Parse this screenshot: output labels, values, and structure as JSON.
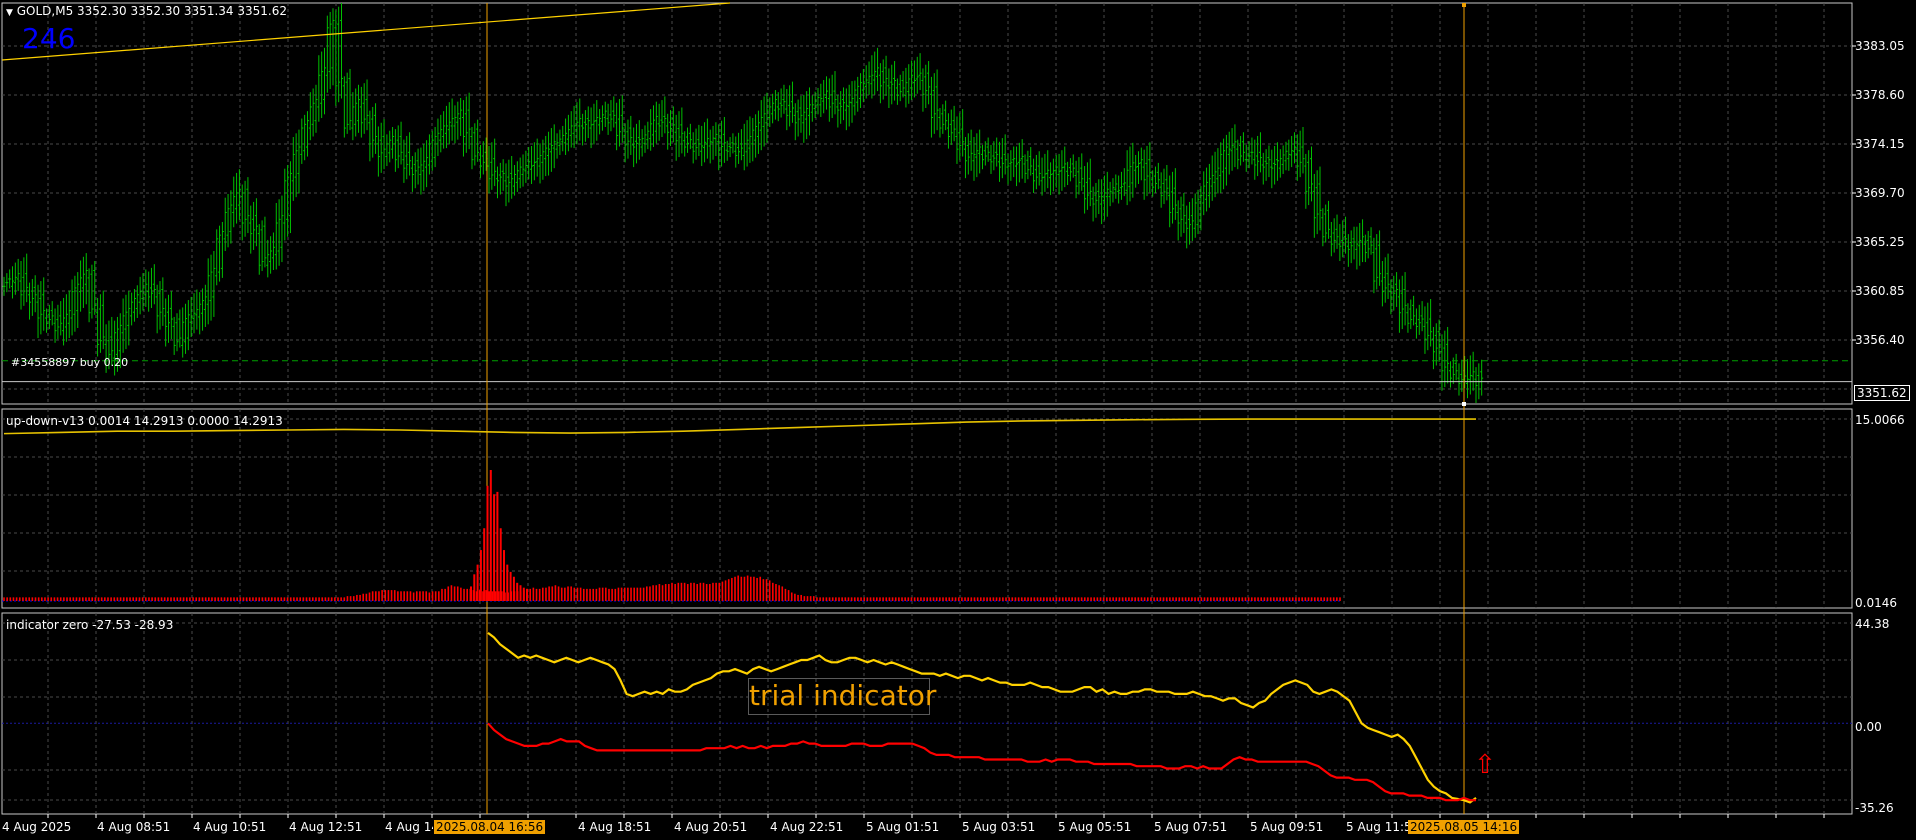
{
  "main_panel": {
    "header": "GOLD,M5  3352.30 3352.30 3351.34 3351.62",
    "counter": "246",
    "order_label": "#34558897 buy 0.20",
    "current_price": "3351.62",
    "y_ticks": [
      "3383.05",
      "3378.60",
      "3374.15",
      "3369.70",
      "3365.25",
      "3360.85",
      "3356.40"
    ],
    "order_price": 3353.6,
    "bid": 3351.62
  },
  "updown_panel": {
    "header": "up-down-v13 0.0014 14.2913 0.0000 14.2913",
    "y_top": "15.0066",
    "y_bottom": "0.0146"
  },
  "zero_panel": {
    "header": "indicator zero -27.53 -28.93",
    "watermark": "trial indicator",
    "y_top": "44.38",
    "y_mid": "0.00",
    "y_bottom": "-35.26",
    "arrow": "⇧"
  },
  "x_axis": {
    "labels": [
      "4 Aug 2025",
      "4 Aug 08:51",
      "4 Aug 10:51",
      "4 Aug 12:51",
      "4 Aug 14:51",
      "4 Aug 18:51",
      "4 Aug 20:51",
      "4 Aug 22:51",
      "5 Aug 01:51",
      "5 Aug 03:51",
      "5 Aug 05:51",
      "5 Aug 07:51",
      "5 Aug 09:51",
      "5 Aug 11:51"
    ],
    "marker1": "2025.08.04 16:56",
    "marker2": "2025.08.05 14:16"
  },
  "colors": {
    "bars": "#00c000",
    "grid": "#4a4a4a",
    "yellow": "#ffd200",
    "red": "#ff0000",
    "vline": "#f0a000",
    "blue": "#0000ff",
    "updown_line": "#e6c200"
  },
  "chart_data": [
    {
      "type": "line",
      "title": "GOLD,M5",
      "y_range": [
        3349.5,
        3387.5
      ],
      "series": [
        {
          "name": "GOLD,M5",
          "values": [
            3361,
            3361.5,
            3360.2,
            3359.5,
            3358,
            3357.5,
            3356.8,
            3358,
            3360.5,
            3361.8,
            3358.5,
            3355.5,
            3354.2,
            3356.6,
            3358.2,
            3359.5,
            3360.5,
            3360,
            3358.2,
            3357.2,
            3355.4,
            3357.6,
            3358.1,
            3359.3,
            3362,
            3365.5,
            3368,
            3369.5,
            3367,
            3366,
            3363,
            3364,
            3367,
            3371,
            3373.5,
            3376,
            3378,
            3381,
            3385.5,
            3380,
            3376,
            3378,
            3376.5,
            3374.5,
            3373.3,
            3374.5,
            3373,
            3372.2,
            3371.6,
            3372.5,
            3374.5,
            3375.5,
            3376.2,
            3377,
            3375.2,
            3373,
            3372.4,
            3371.2,
            3371,
            3370.5,
            3371.6,
            3372.1,
            3372.4,
            3373.4,
            3374,
            3374.6,
            3375.5,
            3376.2,
            3376,
            3376.3,
            3376.9,
            3376.5,
            3375.3,
            3374.4,
            3374.2,
            3375,
            3376.4,
            3376.2,
            3375.6,
            3374.8,
            3374.2,
            3373.8,
            3374.3,
            3374.7,
            3373.9,
            3373.8,
            3373.4,
            3374.5,
            3375.8,
            3377,
            3378,
            3377.8,
            3377.2,
            3376.5,
            3377.5,
            3378.2,
            3378.8,
            3378,
            3377.7,
            3378.1,
            3379.6,
            3380.2,
            3381,
            3380,
            3379.8,
            3379.1,
            3380.3,
            3380.5,
            3379.2,
            3377,
            3376,
            3375.2,
            3374,
            3372.9,
            3373.5,
            3373,
            3372.8,
            3372.3,
            3372.4,
            3372.6,
            3371.7,
            3371,
            3371.3,
            3371.6,
            3371.9,
            3371.5,
            3370.5,
            3369.3,
            3368.8,
            3369.5,
            3370,
            3370.1,
            3372,
            3372.3,
            3371.1,
            3370.4,
            3369.6,
            3368,
            3367,
            3366.5,
            3368.9,
            3370.5,
            3371.5,
            3373.5,
            3374,
            3373,
            3373,
            3372.5,
            3372.3,
            3372.2,
            3373.1,
            3373.5,
            3372.4,
            3370,
            3367.5,
            3365.7,
            3365,
            3364.8,
            3364.5,
            3365,
            3364.2,
            3361.5,
            3360.5,
            3360,
            3358.5,
            3357.5,
            3357.2,
            3356,
            3354.8,
            3353,
            3352.3,
            3351.8,
            3352.2,
            3351.6
          ]
        },
        {
          "name": "order",
          "values": [
            3353.6
          ]
        }
      ]
    },
    {
      "type": "bar",
      "title": "up-down-v13",
      "y_range": [
        0,
        15.0066
      ],
      "series": [
        {
          "name": "histogram",
          "values": [
            0.3,
            0.3,
            0.3,
            0.3,
            0.3,
            0.3,
            0.3,
            0.3,
            0.3,
            0.3,
            0.3,
            0.3,
            0.3,
            0.3,
            0.3,
            0.3,
            0.3,
            0.3,
            0.3,
            0.3,
            0.3,
            0.3,
            0.3,
            0.3,
            0.3,
            0.3,
            0.3,
            0.3,
            0.3,
            0.3,
            0.3,
            0.3,
            0.3,
            0.3,
            0.3,
            0.3,
            0.3,
            0.3,
            0.3,
            0.3,
            0.3,
            0.3,
            0.3,
            0.3,
            0.3,
            0.3,
            0.3,
            0.3,
            0.3,
            0.3,
            0.3,
            0.3,
            0.3,
            0.3,
            0.3,
            0.3,
            0.3,
            0.3,
            0.3,
            0.3,
            0.3,
            0.3,
            0.3,
            0.3,
            0.3,
            0.3,
            0.3,
            0.3,
            0.3,
            0.3,
            0.3,
            0.3,
            0.3,
            0.3,
            0.3,
            0.3,
            0.3,
            0.3,
            0.3,
            0.3,
            0.3,
            0.3,
            0.3,
            0.3,
            0.3,
            0.3,
            0.3,
            0.3,
            0.3,
            0.3,
            0.3,
            0.3,
            0.3,
            0.3,
            0.3,
            0.3,
            0.3,
            0.3,
            0.3,
            0.3,
            0.3,
            0.3,
            0.3,
            0.3,
            0.3,
            0.3,
            0.3,
            0.3,
            0.3,
            0.4,
            0.4,
            0.4,
            0.5,
            0.5,
            0.6,
            0.6,
            0.7,
            0.8,
            0.8,
            0.8,
            0.9,
            0.9,
            0.9,
            0.9,
            0.9,
            0.8,
            0.8,
            0.8,
            0.8,
            0.8,
            0.7,
            0.8,
            0.8,
            0.8,
            0.8,
            0.7,
            0.8,
            0.8,
            0.8,
            1.0,
            1.0,
            1.2,
            1.3,
            1.2,
            1.2,
            1.1,
            1.0,
            1.0,
            1.0,
            0.9,
            0.8,
            0.9,
            0.8,
            0.9,
            0.8,
            0.8,
            0.8,
            0.8,
            0.8,
            0.7,
            0.7,
            0.8,
            0.8,
            0.8,
            0.8,
            0.9,
            1.0,
            1.0,
            1.1,
            1.0,
            1.0,
            1.1,
            1.1,
            1.2,
            1.2,
            1.3,
            1.2,
            1.1,
            1.1,
            1.2,
            1.2,
            1.1,
            1.1,
            1.1,
            1.0,
            1.0,
            1.0,
            1.0,
            1.0,
            1.1,
            1.1,
            1.1,
            1.0,
            1.0,
            1.0,
            1.1,
            1.1,
            1.1,
            1.1,
            1.1,
            1.1,
            1.1,
            1.1,
            1.1,
            1.2,
            1.2,
            1.3,
            1.3,
            1.4,
            1.3,
            1.4,
            1.4,
            1.5,
            1.4,
            1.5,
            1.5,
            1.5,
            1.4,
            1.5,
            1.5,
            1.4,
            1.5,
            1.5,
            1.4,
            1.4,
            1.5,
            1.5,
            1.5,
            1.6,
            1.7,
            1.8,
            1.9,
            2.0,
            2.1,
            2.0,
            2.0,
            2.1,
            2.0,
            2.0,
            1.9,
            2.0,
            1.8,
            1.8,
            1.7,
            1.5,
            1.4,
            1.3,
            1.2,
            1.0,
            0.9,
            0.7,
            0.6,
            0.5,
            0.5,
            0.4,
            0.4,
            0.4,
            0.4,
            0.3,
            0.3,
            0.3,
            0.3,
            0.3,
            0.3,
            0.3,
            0.3,
            0.3,
            0.3,
            0.3,
            0.3,
            0.3,
            0.3,
            0.3,
            0.3,
            0.3,
            0.3,
            0.3,
            0.3,
            0.3,
            0.3,
            0.3,
            0.3,
            0.3,
            0.3,
            0.3,
            0.3,
            0.3,
            0.3,
            0.3,
            0.3,
            0.3,
            0.3,
            0.3,
            0.3,
            0.3,
            0.3,
            0.3,
            0.3,
            0.3,
            0.3,
            0.3,
            0.3,
            0.3,
            0.3,
            0.3,
            0.3,
            0.3,
            0.3,
            0.3,
            0.3,
            0.3,
            0.3,
            0.3,
            0.3,
            0.3,
            0.3,
            0.3,
            0.3,
            0.3,
            0.3,
            0.3,
            0.3,
            0.3,
            0.3,
            0.3,
            0.3,
            0.3,
            0.3,
            0.3,
            0.3,
            0.3,
            0.3,
            0.3,
            0.3,
            0.3,
            0.3,
            0.3,
            0.3,
            0.3,
            0.3,
            0.3,
            0.3,
            0.3,
            0.3,
            0.3,
            0.3,
            0.3,
            0.3,
            0.3,
            0.3,
            0.3,
            0.3,
            0.3,
            0.3,
            0.3,
            0.3,
            0.3,
            0.3,
            0.3,
            0.3,
            0.3,
            0.3,
            0.3,
            0.3,
            0.3,
            0.3,
            0.3,
            0.3,
            0.3,
            0.3,
            0.3,
            0.3,
            0.3,
            0.3,
            0.3,
            0.3,
            0.3,
            0.3,
            0.3,
            0.3,
            0.3,
            0.3,
            0.3,
            0.3,
            0.3,
            0.3,
            0.3,
            0.3,
            0.3,
            0.3,
            0.3,
            0.3,
            0.3,
            0.3,
            0.3,
            0.3,
            0.3,
            0.3,
            0.3,
            0.3,
            0.3,
            0.3,
            0.3,
            0.3,
            0.3,
            0.3,
            0.3,
            0.3,
            0.3,
            0.3,
            0.3,
            0.3,
            0.3,
            0.3,
            0.3,
            0.3,
            0.3,
            0.3,
            0.3,
            0.3,
            0.3,
            0.3,
            0.3,
            0.3,
            0.3
          ]
        },
        {
          "name": "spike",
          "values": [
            1.2,
            2.2,
            3.0,
            4.2,
            6.0,
            9.5,
            10.8,
            8.8,
            9.0,
            6.0,
            4.2,
            3.0,
            2.4,
            2.0,
            1.5,
            1.3,
            1.1,
            1.0
          ]
        },
        {
          "name": "up-down line",
          "values": [
            13.8,
            13.9,
            14.0,
            14.0,
            14.05,
            14.1,
            14.15,
            14.1,
            14.0,
            13.9,
            13.85,
            13.9,
            14.0,
            14.15,
            14.3,
            14.45,
            14.6,
            14.75,
            14.85,
            14.9,
            14.95,
            14.98,
            15.0,
            15.0,
            15.0,
            15.0,
            15.0
          ]
        }
      ]
    },
    {
      "type": "line",
      "title": "indicator zero",
      "y_range": [
        -35.26,
        44.38
      ],
      "series": [
        {
          "name": "yellow",
          "values": [
            40,
            38,
            35,
            33,
            31,
            29,
            30,
            29,
            30,
            29,
            28,
            27,
            28,
            29,
            28,
            27,
            28,
            29,
            28,
            27,
            26,
            24,
            19,
            13,
            12,
            13,
            14,
            13,
            14,
            13,
            15,
            14,
            14,
            15,
            17,
            18,
            19,
            20,
            22,
            23,
            23,
            24,
            23,
            22,
            24,
            25,
            24,
            23,
            24,
            25,
            26,
            27,
            28,
            28,
            29,
            30,
            28,
            27,
            27,
            28,
            29,
            29,
            28,
            27,
            28,
            27,
            26,
            27,
            26,
            25,
            24,
            23,
            22,
            22,
            22,
            21,
            22,
            21,
            20,
            21,
            21,
            20,
            19,
            20,
            19,
            18,
            18,
            17,
            17,
            17,
            18,
            17,
            16,
            16,
            15,
            14,
            14,
            14,
            15,
            16,
            16,
            14,
            15,
            13,
            14,
            13,
            13,
            14,
            14,
            15,
            15,
            14,
            14,
            14,
            13,
            13,
            13,
            14,
            13,
            12,
            12,
            11,
            10,
            11,
            11,
            9,
            8,
            7,
            9,
            10,
            13,
            15,
            17,
            18,
            19,
            18,
            17,
            14,
            13,
            14,
            15,
            14,
            12,
            10,
            5,
            0,
            -2,
            -3,
            -4,
            -5,
            -6,
            -5,
            -7,
            -10,
            -15,
            -20,
            -25,
            -28,
            -30,
            -31,
            -33,
            -33.5,
            -34,
            -35,
            -33
          ]
        },
        {
          "name": "red",
          "values": [
            0,
            -3,
            -5,
            -7,
            -8,
            -9,
            -10,
            -10,
            -10,
            -9,
            -9,
            -8,
            -7,
            -8,
            -8,
            -8,
            -10,
            -11,
            -12,
            -12,
            -12,
            -12,
            -12,
            -12,
            -12,
            -12,
            -12,
            -12,
            -12,
            -12,
            -12,
            -12,
            -12,
            -12,
            -12,
            -12,
            -11,
            -11,
            -11,
            -11,
            -10,
            -11,
            -10,
            -11,
            -11,
            -10,
            -11,
            -10,
            -10,
            -10,
            -9,
            -9,
            -8,
            -9,
            -9,
            -10,
            -10,
            -10,
            -10,
            -10,
            -9,
            -9,
            -9,
            -10,
            -10,
            -10,
            -9,
            -9,
            -9,
            -9,
            -9,
            -10,
            -11,
            -13,
            -14,
            -14,
            -14,
            -15,
            -15,
            -15,
            -15,
            -15,
            -16,
            -16,
            -16,
            -16,
            -16,
            -16,
            -16,
            -17,
            -17,
            -17,
            -16,
            -17,
            -16,
            -16,
            -16,
            -17,
            -17,
            -17,
            -18,
            -18,
            -18,
            -18,
            -18,
            -18,
            -18,
            -19,
            -19,
            -19,
            -19,
            -19,
            -20,
            -20,
            -20,
            -19,
            -19,
            -20,
            -19,
            -20,
            -20,
            -20,
            -18,
            -16,
            -15,
            -16,
            -16,
            -17,
            -17,
            -17,
            -17,
            -17,
            -17,
            -17,
            -17,
            -17,
            -18,
            -19,
            -21,
            -23,
            -24,
            -24,
            -24,
            -25,
            -25,
            -25,
            -26,
            -28,
            -30,
            -31,
            -31,
            -31,
            -32,
            -32,
            -32,
            -33,
            -33,
            -33,
            -34,
            -34,
            -34,
            -33,
            -34,
            -34
          ]
        }
      ]
    }
  ]
}
